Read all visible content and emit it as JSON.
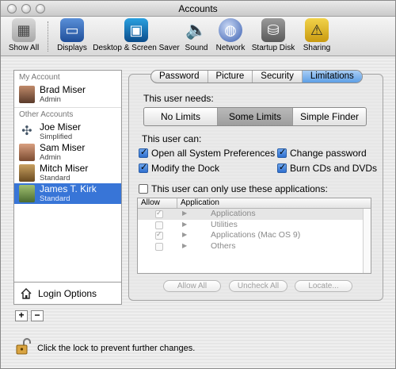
{
  "window": {
    "title": "Accounts"
  },
  "toolbar": {
    "items": [
      {
        "label": "Show All",
        "icon": "apple-grid-icon"
      },
      {
        "label": "Displays",
        "icon": "monitor-icon"
      },
      {
        "label": "Desktop & Screen Saver",
        "icon": "desktop-icon"
      },
      {
        "label": "Sound",
        "icon": "speaker-icon"
      },
      {
        "label": "Network",
        "icon": "globe-icon"
      },
      {
        "label": "Startup Disk",
        "icon": "disk-icon"
      },
      {
        "label": "Sharing",
        "icon": "sharing-icon"
      }
    ]
  },
  "sidebar": {
    "my_account_label": "My Account",
    "my_account": {
      "name": "Brad Miser",
      "role": "Admin"
    },
    "other_accounts_label": "Other Accounts",
    "others": [
      {
        "name": "Joe Miser",
        "role": "Simplified"
      },
      {
        "name": "Sam Miser",
        "role": "Admin"
      },
      {
        "name": "Mitch Miser",
        "role": "Standard"
      },
      {
        "name": "James T. Kirk",
        "role": "Standard"
      }
    ],
    "selected_index": 3,
    "login_options": "Login Options",
    "add_label": "+",
    "remove_label": "−"
  },
  "tabs": [
    "Password",
    "Picture",
    "Security",
    "Limitations"
  ],
  "active_tab": "Limitations",
  "limits": {
    "needs_label": "This user needs:",
    "options": [
      "No Limits",
      "Some Limits",
      "Simple Finder"
    ],
    "selected": "Some Limits",
    "can_label": "This user can:",
    "permissions": [
      {
        "label": "Open all System Preferences",
        "checked": true
      },
      {
        "label": "Change password",
        "checked": true
      },
      {
        "label": "Modify the Dock",
        "checked": true
      },
      {
        "label": "Burn CDs and DVDs",
        "checked": true
      }
    ],
    "only_apps_label": "This user can only use these applications:",
    "only_apps_checked": false
  },
  "applist": {
    "col_allow": "Allow",
    "col_application": "Application",
    "rows": [
      {
        "name": "Applications",
        "checked": true
      },
      {
        "name": "Utilities",
        "checked": false
      },
      {
        "name": "Applications (Mac OS 9)",
        "checked": true
      },
      {
        "name": "Others",
        "checked": false
      }
    ]
  },
  "buttons": {
    "allow_all": "Allow All",
    "uncheck_all": "Uncheck All",
    "locate": "Locate..."
  },
  "lock_message": "Click the lock to prevent further changes.",
  "colors": {
    "selection": "#3875d7",
    "active_tab": "#5e9fe6"
  }
}
